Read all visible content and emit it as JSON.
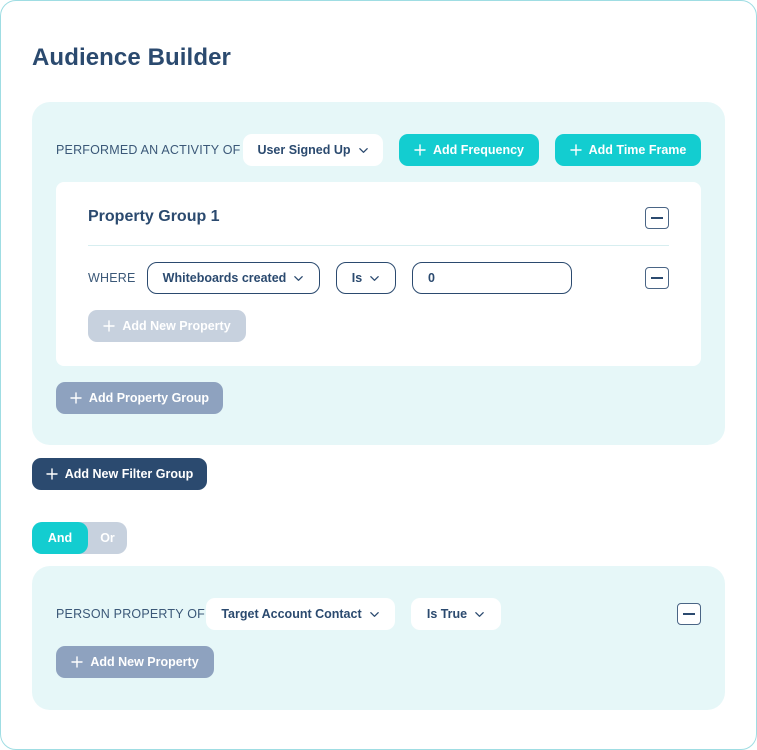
{
  "title": "Audience Builder",
  "activity": {
    "label": "PERFORMED AN ACTIVITY OF",
    "event_value": "User Signed Up",
    "add_frequency": "Add Frequency",
    "add_time_frame": "Add Time Frame"
  },
  "property_group": {
    "title": "Property Group 1",
    "where_label": "WHERE",
    "property_value": "Whiteboards created",
    "operator_value": "Is",
    "input_value": "0",
    "add_new_property": "Add New Property"
  },
  "add_property_group": "Add Property Group",
  "add_new_filter_group": "Add New Filter Group",
  "logic_toggle": {
    "and": "And",
    "or": "Or",
    "selected": "And"
  },
  "person_filter": {
    "label": "PERSON PROPERTY OF",
    "property_value": "Target Account Contact",
    "operator_value": "Is True",
    "add_new_property": "Add New Property"
  },
  "icons": {
    "dropdown": "chevron-down-icon",
    "add": "plus-icon",
    "remove": "minus-icon"
  },
  "colors": {
    "accent_teal": "#13cdd0",
    "navy": "#2b4a6f",
    "panel_bg": "#e6f7f8",
    "muted_button": "#8ea2bf",
    "disabled_button": "#c7d1de",
    "frame_border": "#9fdde3"
  }
}
